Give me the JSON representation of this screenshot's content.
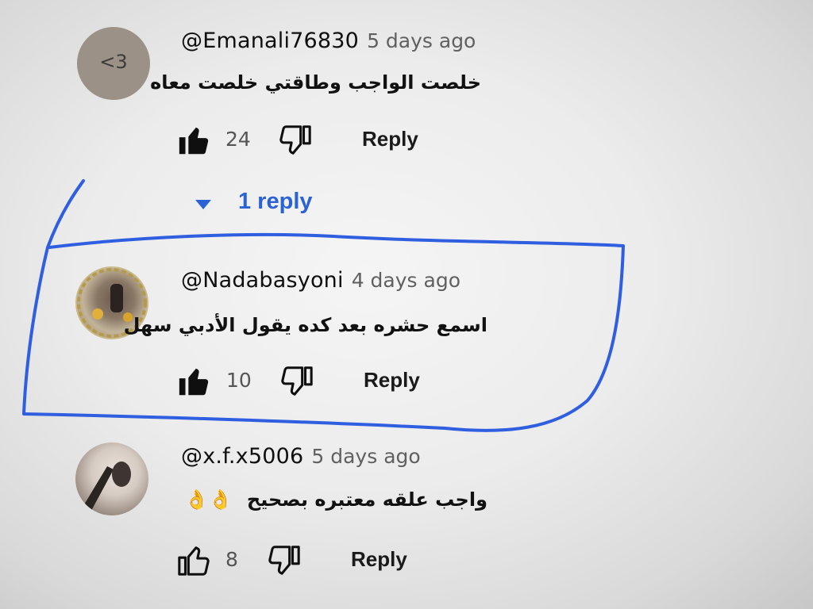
{
  "comments": [
    {
      "avatar_text": "<3",
      "handle": "@Emanali76830",
      "time": "5 days ago",
      "text": "خلصت الواجب وطاقتي خلصت معاه",
      "likes": "24",
      "reply_label": "Reply"
    },
    {
      "handle": "@Nadabasyoni",
      "time": "4 days ago",
      "text": "اسمع حشره بعد كده يقول الأدبي سهل",
      "likes": "10",
      "reply_label": "Reply"
    },
    {
      "handle": "@x.f.x5006",
      "time": "5 days ago",
      "text": "واجب علقه معتبره بصحيح",
      "emoji": "👌👌",
      "likes": "8",
      "reply_label": "Reply"
    }
  ],
  "replies_toggle": {
    "label": "1 reply"
  },
  "colors": {
    "link_blue": "#2a63d4",
    "pen_annotation": "#2f5fe0",
    "text_primary": "#0f0f0f",
    "text_secondary": "#606060"
  }
}
